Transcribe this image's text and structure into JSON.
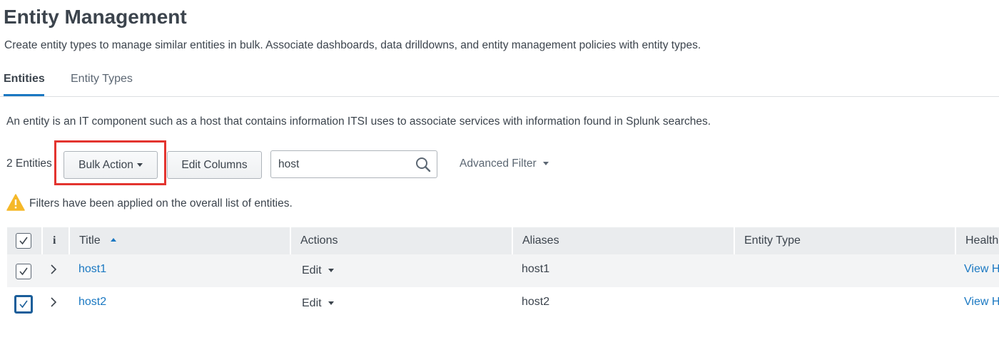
{
  "page": {
    "title": "Entity Management",
    "description": "Create entity types to manage similar entities in bulk. Associate dashboards, data drilldowns, and entity management policies with entity types."
  },
  "tabs": [
    {
      "label": "Entities",
      "active": true
    },
    {
      "label": "Entity Types",
      "active": false
    }
  ],
  "entity_description": "An entity is an IT component such as a host that contains information ITSI uses to associate services with information found in Splunk searches.",
  "toolbar": {
    "count_label": "2 Entities",
    "bulk_action_label": "Bulk Action",
    "edit_columns_label": "Edit Columns",
    "search_value": "host",
    "advanced_filter_label": "Advanced Filter"
  },
  "warning": {
    "icon": "warning-icon",
    "text": "Filters have been applied on the overall list of entities."
  },
  "table": {
    "columns": {
      "info": "i",
      "title": "Title",
      "actions": "Actions",
      "aliases": "Aliases",
      "entity_type": "Entity Type",
      "health": "Health"
    },
    "rows": [
      {
        "title": "host1",
        "action": "Edit",
        "alias": "host1",
        "entity_type": "",
        "health": "View H",
        "checked": true
      },
      {
        "title": "host2",
        "action": "Edit",
        "alias": "host2",
        "entity_type": "",
        "health": "View H",
        "checked": true
      }
    ]
  },
  "colors": {
    "accent": "#1a78c2",
    "highlight": "#e3342f",
    "warning": "#f5b829"
  }
}
